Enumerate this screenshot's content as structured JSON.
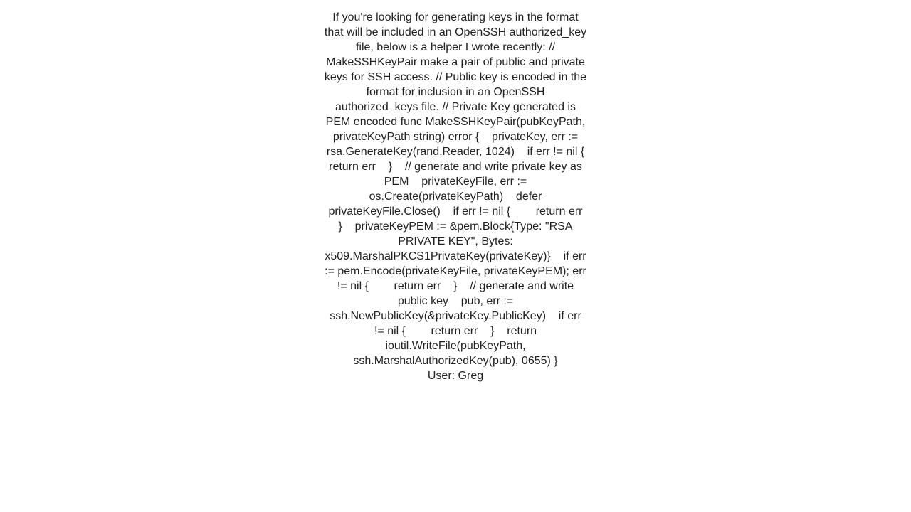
{
  "page": {
    "background_color": "#ffffff",
    "text_color": "#222222"
  },
  "answer": {
    "body": "If you're looking for generating keys in the format that will be included in an OpenSSH authorized_key file, below is a helper I wrote recently: // MakeSSHKeyPair make a pair of public and private keys for SSH access. // Public key is encoded in the format for inclusion in an OpenSSH authorized_keys file. // Private Key generated is PEM encoded func MakeSSHKeyPair(pubKeyPath, privateKeyPath string) error {    privateKey, err := rsa.GenerateKey(rand.Reader, 1024)    if err != nil {        return err    }    // generate and write private key as PEM    privateKeyFile, err := os.Create(privateKeyPath)    defer privateKeyFile.Close()    if err != nil {        return err    }    privateKeyPEM := &pem.Block{Type: \"RSA PRIVATE KEY\", Bytes: x509.MarshalPKCS1PrivateKey(privateKey)}    if err := pem.Encode(privateKeyFile, privateKeyPEM); err != nil {        return err    }    // generate and write public key    pub, err := ssh.NewPublicKey(&privateKey.PublicKey)    if err != nil {        return err    }    return ioutil.WriteFile(pubKeyPath, ssh.MarshalAuthorizedKey(pub), 0655) }"
  },
  "attribution": {
    "user_line": "User: Greg"
  }
}
